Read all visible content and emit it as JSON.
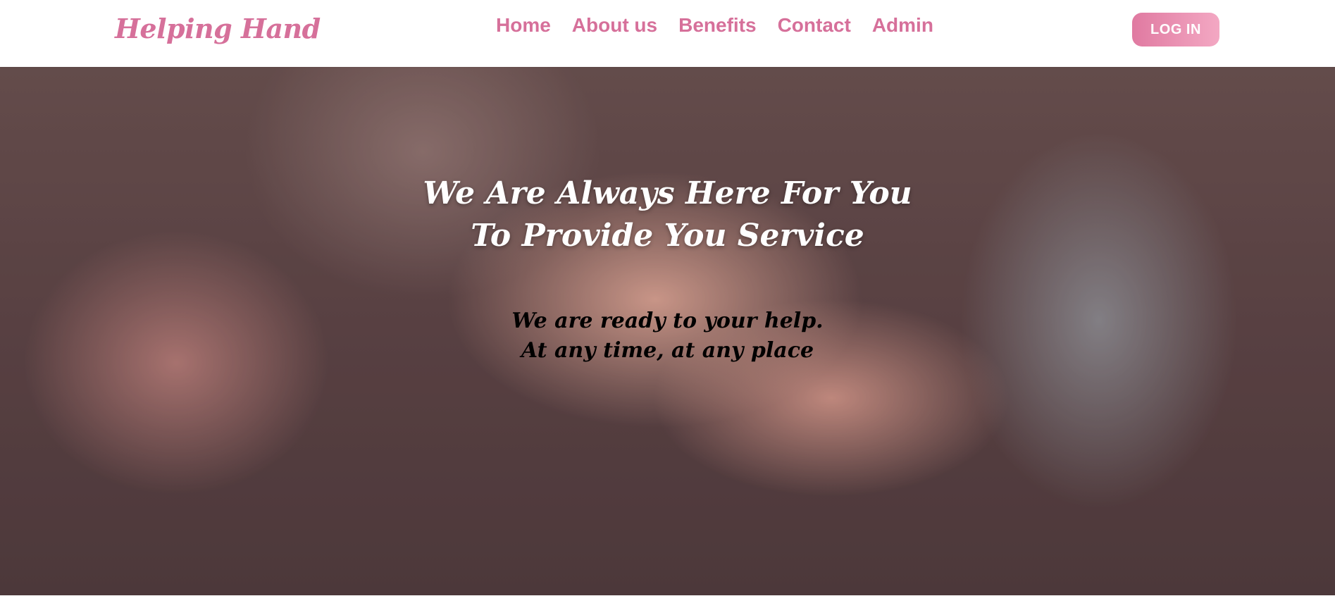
{
  "brand": {
    "name": "Helping Hand"
  },
  "nav": {
    "items": [
      {
        "label": "Home"
      },
      {
        "label": "About us"
      },
      {
        "label": "Benefits"
      },
      {
        "label": "Contact"
      },
      {
        "label": "Admin"
      }
    ],
    "login_label": "LOG IN"
  },
  "hero": {
    "title_line1": "We Are Always Here For You",
    "title_line2": "To Provide You Service",
    "subtitle_line1": "We are ready to your help.",
    "subtitle_line2": "At any time, at any place",
    "image": "hands-holding-photo"
  },
  "colors": {
    "brand_pink": "#d6709a",
    "button_gradient_start": "#e07aa1",
    "button_gradient_end": "#f3a8c3",
    "title_text": "#ffffff",
    "subtitle_text": "#000000"
  }
}
